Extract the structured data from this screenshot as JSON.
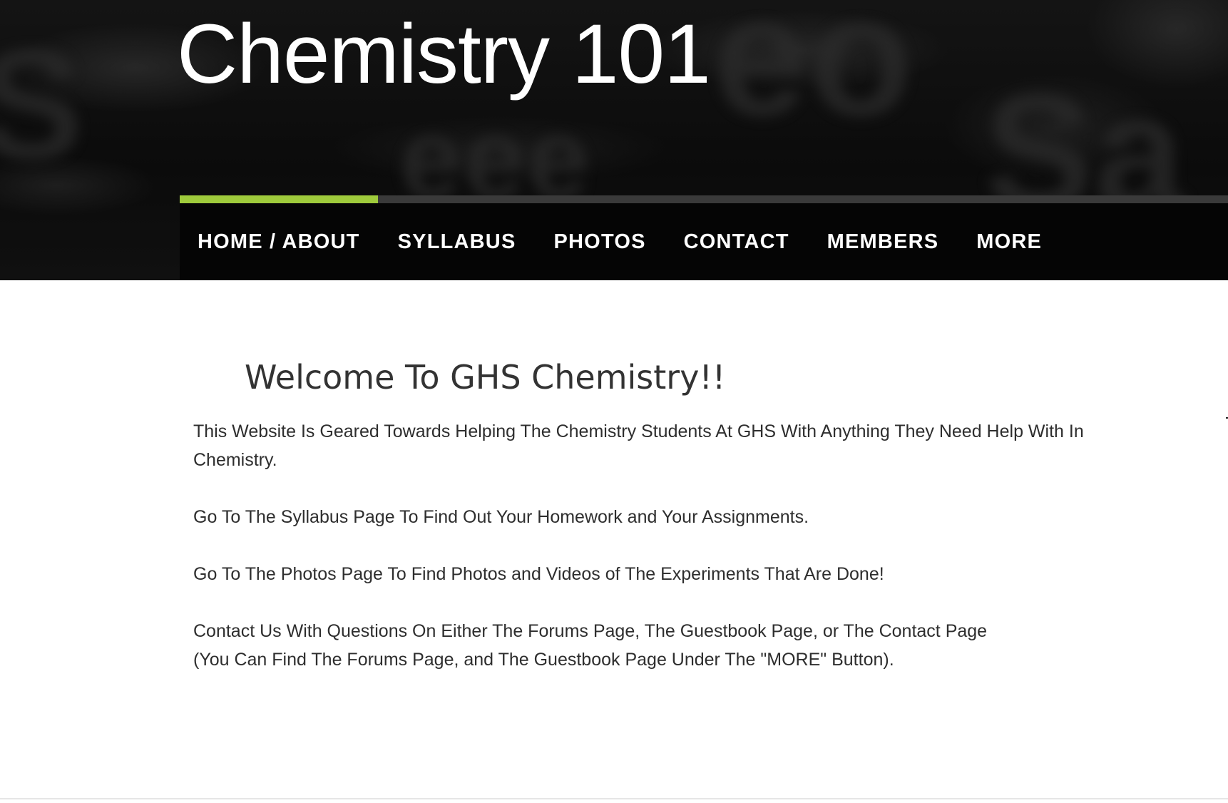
{
  "header": {
    "title": "Chemistry 101"
  },
  "nav": {
    "items": [
      {
        "label": "HOME / ABOUT",
        "active": true
      },
      {
        "label": "SYLLABUS",
        "active": false
      },
      {
        "label": "PHOTOS",
        "active": false
      },
      {
        "label": "CONTACT",
        "active": false
      },
      {
        "label": "MEMBERS",
        "active": false
      },
      {
        "label": "MORE",
        "active": false
      }
    ],
    "active_color": "#9fcb3c"
  },
  "main": {
    "heading": "Welcome To GHS Chemistry!!",
    "paragraphs": [
      "This Website Is Geared Towards Helping The Chemistry Students At GHS With Anything They Need Help With In Chemistry.",
      "Go To The Syllabus Page To Find Out Your Homework and Your Assignments.",
      "Go To The Photos Page To Find Photos and Videos of The Experiments That Are Done!",
      "Contact Us With Questions On Either The Forums Page, The Guestbook Page, or The Contact Page",
      "(You Can Find The Forums Page, and The Guestbook Page Under The \"MORE\" Button)."
    ]
  },
  "colors": {
    "header_background": "#0b0b0b",
    "nav_background": "#050505",
    "text": "#333333"
  }
}
